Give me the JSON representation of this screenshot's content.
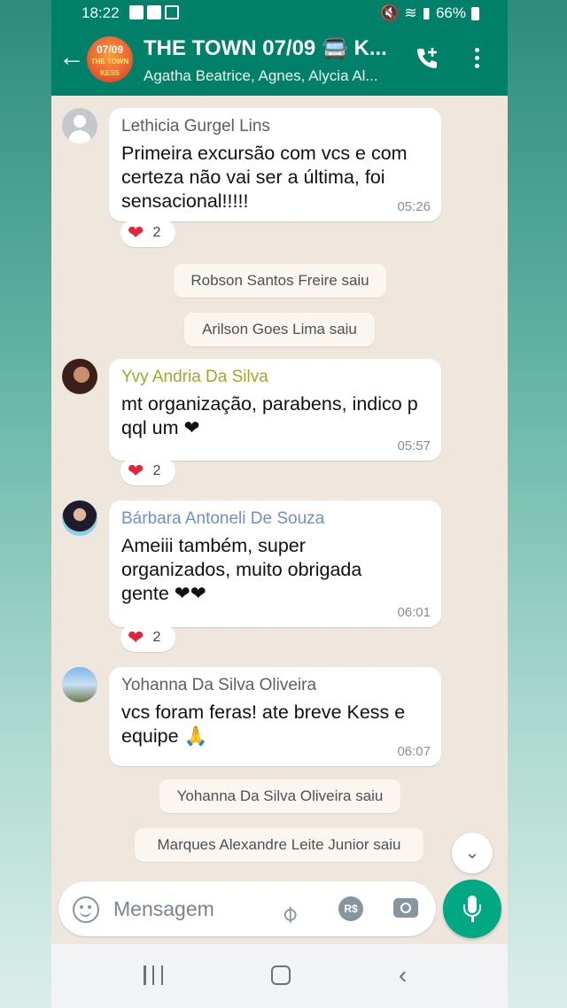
{
  "status_bar": {
    "time": "18:22",
    "battery": "66%"
  },
  "header": {
    "title": "THE TOWN 07/09 🚍 K...",
    "participants": "Agatha Beatrice, Agnes, Alycia Al...",
    "avatar_line1": "07/09",
    "avatar_line2": "THE TOWN",
    "avatar_line3": "KESS"
  },
  "messages": [
    {
      "sender": "Lethicia Gurgel Lins",
      "sender_color": "#5a6066",
      "text": "Primeira excursão com vcs e com certeza não vai ser a última, foi sensacional!!!!!",
      "time": "05:26",
      "reaction": "❤",
      "reaction_count": "2"
    },
    {
      "sender": "Yvy Andria Da Silva",
      "sender_color": "#9aab2c",
      "text": "mt organização, parabens, indico p qql um ❤",
      "time": "05:57",
      "reaction": "❤",
      "reaction_count": "2"
    },
    {
      "sender": "Bárbara Antoneli De Souza",
      "sender_color": "#6f8fd0",
      "text": "Ameiii também, super organizados, muito obrigada gente ❤❤",
      "time": "06:01",
      "reaction": "❤",
      "reaction_count": "2"
    },
    {
      "sender": "Yohanna Da Silva Oliveira",
      "sender_color": "#5a6066",
      "text": "vcs foram feras! ate breve Kess e equipe 🙏",
      "time": "06:07"
    }
  ],
  "system_messages": [
    "Robson Santos Freire saiu",
    "Arilson Goes Lima saiu",
    "Yohanna Da Silva Oliveira saiu",
    "Marques Alexandre Leite Junior saiu"
  ],
  "composer": {
    "placeholder": "Mensagem",
    "pay_label": "R$"
  },
  "colors": {
    "header": "#008069",
    "mic": "#00a884",
    "heart": "#e0263c"
  }
}
